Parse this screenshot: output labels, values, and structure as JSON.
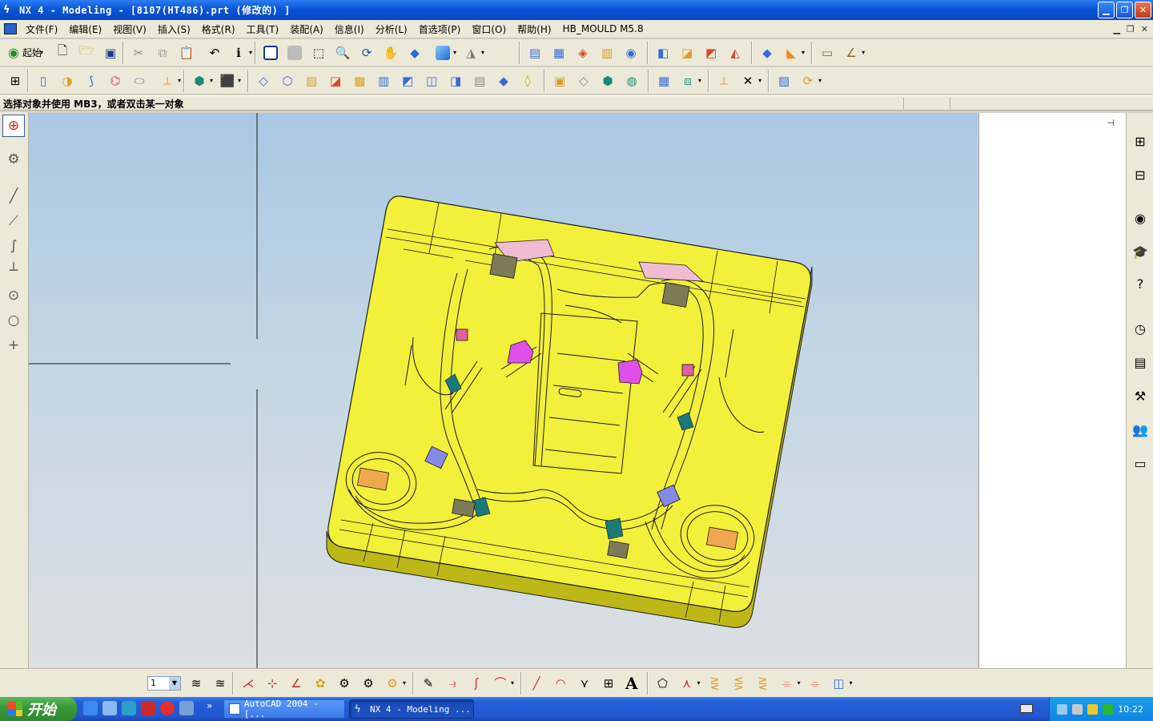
{
  "window": {
    "title": "NX 4 - Modeling - [8107(HT486).prt  (修改的) ]",
    "app_icon": "nx-logo-icon"
  },
  "menu": {
    "items": [
      "文件(F)",
      "编辑(E)",
      "视图(V)",
      "插入(S)",
      "格式(R)",
      "工具(T)",
      "装配(A)",
      "信息(I)",
      "分析(L)",
      "首选项(P)",
      "窗口(O)",
      "帮助(H)",
      "HB_MOULD M5.8"
    ]
  },
  "toolbar": {
    "start_label": "起始"
  },
  "status": {
    "prompt": "选择对象并使用 MB3，或者双击某一对象"
  },
  "bottom_toolbar": {
    "layer_value": "1"
  },
  "taskbar": {
    "start_label": "开始",
    "chevron": "»",
    "tasks": [
      {
        "label": "AutoCAD 2004 - [..."
      },
      {
        "label": "NX 4 - Modeling ..."
      }
    ],
    "clock": "10:22"
  },
  "colors": {
    "part_yellow": "#f2f03a",
    "part_side": "#bdb818",
    "pink_pad": "#f0bcd4",
    "magenta_pad": "#e050e8",
    "orange_pad": "#f0a850",
    "lavender_pad": "#8888e8",
    "teal_pad": "#1a7a7a",
    "olive_block": "#7e7a58"
  }
}
